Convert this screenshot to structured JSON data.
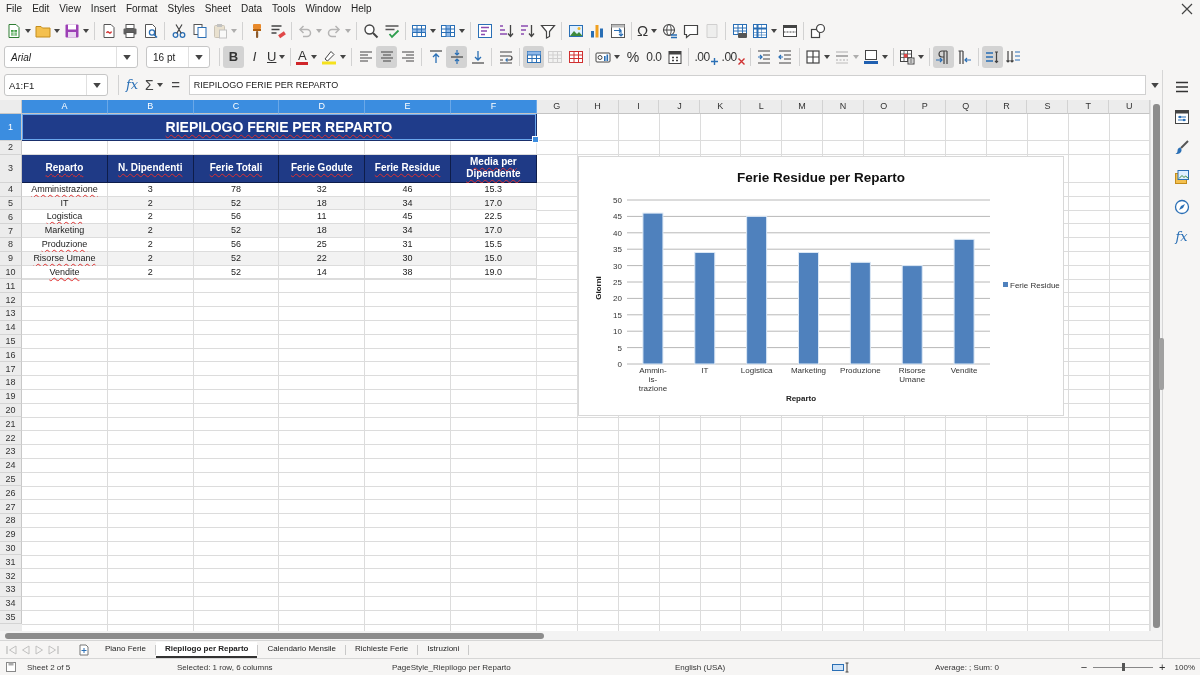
{
  "menu_bar": {
    "items": [
      "File",
      "Edit",
      "View",
      "Insert",
      "Format",
      "Styles",
      "Sheet",
      "Data",
      "Tools",
      "Window",
      "Help"
    ]
  },
  "standard_toolbar": {
    "buttons": [
      {
        "disabled": false
      },
      {
        "disabled": false
      },
      {
        "disabled": false
      },
      {
        "disabled": false
      },
      {
        "disabled": false
      },
      {
        "disabled": false
      },
      {
        "disabled": false
      },
      {
        "disabled": false
      },
      {
        "disabled": true
      },
      {
        "disabled": false
      },
      {
        "disabled": false
      },
      {
        "disabled": true
      },
      {
        "disabled": true
      },
      {
        "disabled": false
      },
      {
        "disabled": false
      },
      {
        "disabled": false
      },
      {
        "disabled": false
      },
      {
        "disabled": false
      },
      {
        "disabled": false
      },
      {
        "disabled": false
      },
      {
        "disabled": false
      },
      {
        "disabled": false
      },
      {
        "disabled": false
      },
      {
        "disabled": false
      },
      {
        "label": "Ω",
        "disabled": false
      },
      {
        "disabled": false
      },
      {
        "disabled": false
      },
      {
        "disabled": true
      },
      {
        "disabled": false
      },
      {
        "disabled": false
      },
      {
        "disabled": false
      },
      {
        "disabled": false
      }
    ]
  },
  "formatting_toolbar": {
    "font_name": "Arial",
    "font_size": "16 pt",
    "buttons": [
      {
        "label": "B",
        "pressed": true,
        "disabled": false
      },
      {
        "label": "I",
        "pressed": false,
        "disabled": false
      },
      {
        "label": "U",
        "pressed": false,
        "disabled": false
      },
      {
        "label": "A",
        "pressed": false,
        "disabled": false
      },
      {
        "pressed": false,
        "disabled": false
      },
      {
        "pressed": false,
        "disabled": false
      },
      {
        "pressed": true,
        "disabled": false
      },
      {
        "pressed": false,
        "disabled": false
      },
      {
        "pressed": false,
        "disabled": false
      },
      {
        "pressed": true,
        "disabled": false
      },
      {
        "pressed": false,
        "disabled": false
      },
      {
        "pressed": false,
        "disabled": false
      },
      {
        "pressed": true,
        "disabled": false
      },
      {
        "pressed": false,
        "disabled": true
      },
      {
        "pressed": false,
        "disabled": false
      },
      {
        "pressed": false,
        "disabled": false
      },
      {
        "label": "%",
        "pressed": false,
        "disabled": false
      },
      {
        "label": "0.0",
        "pressed": false,
        "disabled": false
      },
      {
        "pressed": false,
        "disabled": false
      },
      {
        "label": ".00",
        "pressed": false,
        "disabled": false
      },
      {
        "label": ".00",
        "pressed": false,
        "disabled": false
      },
      {
        "pressed": false,
        "disabled": false
      },
      {
        "pressed": false,
        "disabled": false
      },
      {
        "pressed": false,
        "disabled": false
      },
      {
        "pressed": false,
        "disabled": true
      },
      {
        "pressed": false,
        "disabled": false
      },
      {
        "pressed": false,
        "disabled": false
      },
      {
        "pressed": true,
        "disabled": false
      },
      {
        "pressed": false,
        "disabled": false
      },
      {
        "pressed": true,
        "disabled": false
      },
      {
        "pressed": false,
        "disabled": false
      }
    ]
  },
  "formula_bar": {
    "name_box": "A1:F1",
    "function_wizard": "fx",
    "sum": "Σ",
    "formula": "=",
    "content": "RIEPILOGO FERIE PER REPARTO"
  },
  "spreadsheet": {
    "columns": [
      {
        "label": "A",
        "selected": true
      },
      {
        "label": "B",
        "selected": true
      },
      {
        "label": "C",
        "selected": true
      },
      {
        "label": "D",
        "selected": true
      },
      {
        "label": "E",
        "selected": true
      },
      {
        "label": "F",
        "selected": true
      },
      {
        "label": "G",
        "selected": false
      },
      {
        "label": "H",
        "selected": false
      },
      {
        "label": "I",
        "selected": false
      },
      {
        "label": "J",
        "selected": false
      },
      {
        "label": "K",
        "selected": false
      },
      {
        "label": "L",
        "selected": false
      },
      {
        "label": "M",
        "selected": false
      },
      {
        "label": "N",
        "selected": false
      },
      {
        "label": "O",
        "selected": false
      },
      {
        "label": "P",
        "selected": false
      },
      {
        "label": "Q",
        "selected": false
      },
      {
        "label": "R",
        "selected": false
      },
      {
        "label": "S",
        "selected": false
      },
      {
        "label": "T",
        "selected": false
      },
      {
        "label": "U",
        "selected": false
      }
    ],
    "rows": [
      {
        "label": "1",
        "selected": true
      },
      {
        "label": "2",
        "selected": false
      },
      {
        "label": "3",
        "selected": false
      },
      {
        "label": "4",
        "selected": false
      },
      {
        "label": "5",
        "selected": false
      },
      {
        "label": "6",
        "selected": false
      },
      {
        "label": "7",
        "selected": false
      },
      {
        "label": "8",
        "selected": false
      },
      {
        "label": "9",
        "selected": false
      },
      {
        "label": "10",
        "selected": false
      },
      {
        "label": "11",
        "selected": false
      },
      {
        "label": "12",
        "selected": false
      },
      {
        "label": "13",
        "selected": false
      },
      {
        "label": "14",
        "selected": false
      },
      {
        "label": "15",
        "selected": false
      },
      {
        "label": "16",
        "selected": false
      },
      {
        "label": "17",
        "selected": false
      },
      {
        "label": "18",
        "selected": false
      },
      {
        "label": "19",
        "selected": false
      },
      {
        "label": "20",
        "selected": false
      },
      {
        "label": "21",
        "selected": false
      },
      {
        "label": "22",
        "selected": false
      },
      {
        "label": "23",
        "selected": false
      },
      {
        "label": "24",
        "selected": false
      },
      {
        "label": "25",
        "selected": false
      },
      {
        "label": "26",
        "selected": false
      },
      {
        "label": "27",
        "selected": false
      },
      {
        "label": "28",
        "selected": false
      },
      {
        "label": "29",
        "selected": false
      },
      {
        "label": "30",
        "selected": false
      },
      {
        "label": "31",
        "selected": false
      },
      {
        "label": "32",
        "selected": false
      },
      {
        "label": "33",
        "selected": false
      },
      {
        "label": "34",
        "selected": false
      },
      {
        "label": "35",
        "selected": false
      }
    ],
    "title": {
      "text": "RIEPILOGO FERIE PER REPARTO",
      "misspelled": true,
      "selected": true
    },
    "header_row": {
      "cells": [
        "Reparto",
        "N. Dipendenti",
        "Ferie Totali",
        "Ferie Godute",
        "Ferie Residue",
        "Media per Dipendente"
      ],
      "misspelled": true
    },
    "data_rows": [
      {
        "cells": [
          "Amministrazione",
          "3",
          "78",
          "32",
          "46",
          "15.3"
        ],
        "misspelled": true
      },
      {
        "cells": [
          "IT",
          "2",
          "52",
          "18",
          "34",
          "17.0"
        ],
        "misspelled": false
      },
      {
        "cells": [
          "Logistica",
          "2",
          "56",
          "11",
          "45",
          "22.5"
        ],
        "misspelled": true
      },
      {
        "cells": [
          "Marketing",
          "2",
          "52",
          "18",
          "34",
          "17.0"
        ],
        "misspelled": false
      },
      {
        "cells": [
          "Produzione",
          "2",
          "56",
          "25",
          "31",
          "15.5"
        ],
        "misspelled": true
      },
      {
        "cells": [
          "Risorse Umane",
          "2",
          "52",
          "22",
          "30",
          "15.0"
        ],
        "misspelled": true
      },
      {
        "cells": [
          "Vendite",
          "2",
          "52",
          "14",
          "38",
          "19.0"
        ],
        "misspelled": true
      }
    ],
    "chart": {
      "chart_data": {
        "type": "bar",
        "title": "Ferie Residue per Reparto",
        "xlabel": "Reparto",
        "ylabel": "Giorni",
        "categories": [
          "Ammin- is- trazione",
          "IT",
          "Logistica",
          "Marketing",
          "Produzione",
          "Risorse Umane",
          "Vendite"
        ],
        "series": [
          {
            "name": "Ferie Residue",
            "color": "#4f81bd",
            "values": [
              46,
              34,
              45,
              34,
              31,
              30,
              38
            ]
          }
        ],
        "ylim": [
          0,
          50
        ],
        "yticks": [
          0,
          5,
          10,
          15,
          20,
          25,
          30,
          35,
          40,
          45,
          50
        ],
        "grid": true
      }
    }
  },
  "sidebar": {
    "functions_button": "fx"
  },
  "sheet_tabs": {
    "navigation": [
      {
        "disabled": true
      },
      {
        "disabled": true
      },
      {
        "disabled": true
      },
      {
        "disabled": true
      }
    ],
    "tabs": [
      {
        "label": "Piano Ferie",
        "selected": false
      },
      {
        "label": "Riepilogo per Reparto",
        "selected": true
      },
      {
        "label": "Calendario Mensile",
        "selected": false
      },
      {
        "label": "Richieste Ferie",
        "selected": false
      },
      {
        "label": "Istruzioni",
        "selected": false
      }
    ]
  },
  "status_bar": {
    "sheet": "Sheet 2 of 5",
    "selection": "Selected: 1 row, 6 columns",
    "page_style": "PageStyle_Riepilogo per Reparto",
    "language": "English (USA)",
    "summary": "Average: ; Sum: 0",
    "zoom_out": "−",
    "zoom_slider": {
      "level": 0.5
    },
    "zoom_in": "+",
    "zoom": "100%"
  }
}
